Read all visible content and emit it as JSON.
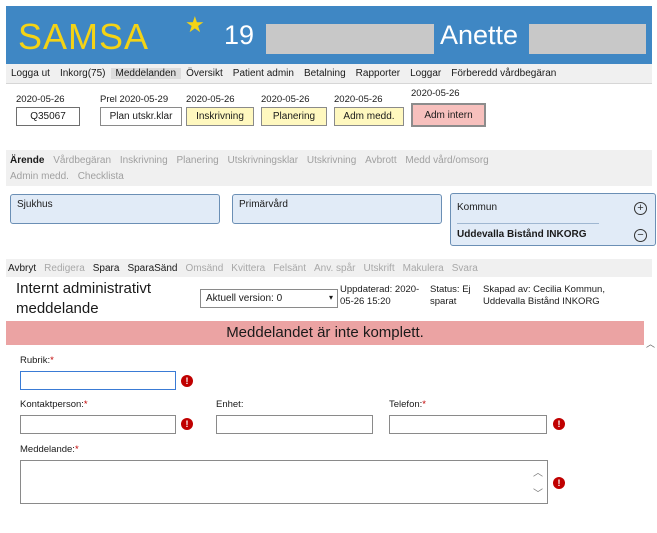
{
  "header": {
    "app_name": "SAMSA",
    "star_icon": "star-icon",
    "patient_number": "19",
    "user_name": "Anette",
    "bg_color": "#3f87c4",
    "accent_color": "#f4d315"
  },
  "menu": {
    "items": [
      "Logga ut",
      "Inkorg(75)",
      "Meddelanden",
      "Översikt",
      "Patient admin",
      "Betalning",
      "Rapporter",
      "Loggar",
      "Förberedd vårdbegäran"
    ],
    "active": "Meddelanden"
  },
  "dates": {
    "case": {
      "date": "2020-05-26",
      "label": "Q35067"
    },
    "plan": {
      "date": "Prel 2020-05-29",
      "label": "Plan utskr.klar"
    },
    "inskrivning": {
      "date": "2020-05-26",
      "label": "Inskrivning"
    },
    "planering": {
      "date": "2020-05-26",
      "label": "Planering"
    },
    "adm_medd": {
      "date": "2020-05-26",
      "label": "Adm medd."
    },
    "adm_intern": {
      "date": "2020-05-26",
      "label": "Adm intern"
    }
  },
  "tabs": {
    "row1": [
      "Ärende",
      "Vårdbegäran",
      "Inskrivning",
      "Planering",
      "Utskrivningsklar",
      "Utskrivning",
      "Avbrott",
      "Medd vård/omsorg"
    ],
    "row2": [
      "Admin medd.",
      "Checklista"
    ],
    "active": "Ärende"
  },
  "boxes": {
    "sjukhus": "Sjukhus",
    "primarvard": "Primärvård",
    "kommun": "Kommun",
    "kommun_value": "Uddevalla Bistånd INKORG",
    "add_icon": "plus-circle-icon",
    "remove_icon": "minus-circle-icon"
  },
  "actions": {
    "items": [
      {
        "label": "Avbryt",
        "enabled": true
      },
      {
        "label": "Redigera",
        "enabled": false
      },
      {
        "label": "Spara",
        "enabled": true
      },
      {
        "label": "SparaSänd",
        "enabled": true
      },
      {
        "label": "Omsänd",
        "enabled": false
      },
      {
        "label": "Kvittera",
        "enabled": false
      },
      {
        "label": "Felsänt",
        "enabled": false
      },
      {
        "label": "Anv. spår",
        "enabled": false
      },
      {
        "label": "Utskrift",
        "enabled": false
      },
      {
        "label": "Makulera",
        "enabled": false
      },
      {
        "label": "Svara",
        "enabled": false
      }
    ]
  },
  "message": {
    "title": "Internt administrativt meddelande",
    "version_select": "Aktuell version: 0",
    "updated": "Uppdaterad: 2020-05-26 15:20",
    "status": "Status: Ej sparat",
    "created_by": "Skapad av: Cecilia Kommun, Uddevalla Bistånd INKORG",
    "error_banner": "Meddelandet är inte komplett.",
    "banner_color": "#eba3a3"
  },
  "form": {
    "rubrik_label": "Rubrik:",
    "kontaktperson_label": "Kontaktperson:",
    "enhet_label": "Enhet:",
    "telefon_label": "Telefon:",
    "meddelande_label": "Meddelande:",
    "required_mark": "*",
    "error_icon": "error-icon"
  }
}
